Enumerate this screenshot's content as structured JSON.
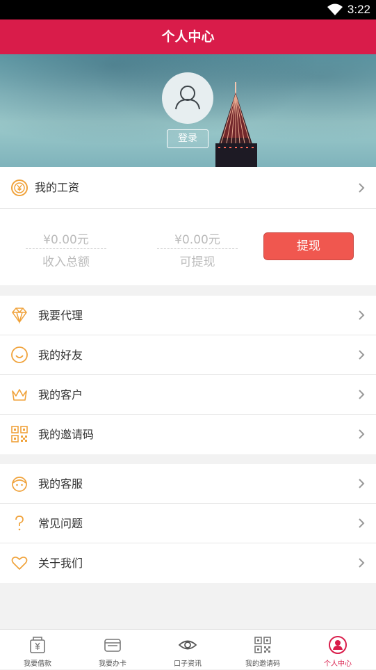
{
  "status_bar": {
    "time": "3:22"
  },
  "header": {
    "title": "个人中心"
  },
  "profile": {
    "login_label": "登录"
  },
  "salary": {
    "label": "我的工资",
    "total_income_value": "¥0.00元",
    "total_income_caption": "收入总额",
    "withdrawable_value": "¥0.00元",
    "withdrawable_caption": "可提现",
    "withdraw_button": "提现"
  },
  "menu_group_1": [
    {
      "label": "我要代理",
      "icon": "diamond-icon"
    },
    {
      "label": "我的好友",
      "icon": "smile-icon"
    },
    {
      "label": "我的客户",
      "icon": "crown-icon"
    },
    {
      "label": "我的邀请码",
      "icon": "qrcode-icon"
    }
  ],
  "menu_group_2": [
    {
      "label": "我的客服",
      "icon": "service-icon"
    },
    {
      "label": "常见问题",
      "icon": "question-icon"
    },
    {
      "label": "关于我们",
      "icon": "heart-icon"
    }
  ],
  "tabs": [
    {
      "label": "我要借款",
      "icon": "loan-icon"
    },
    {
      "label": "我要办卡",
      "icon": "card-icon"
    },
    {
      "label": "口子资讯",
      "icon": "eye-icon"
    },
    {
      "label": "我的邀请码",
      "icon": "qrcode-icon"
    },
    {
      "label": "个人中心",
      "icon": "user-icon",
      "active": true
    }
  ],
  "colors": {
    "brand": "#d91c4a",
    "accent_icon": "#f0a23a",
    "withdraw_button": "#f0574f"
  }
}
